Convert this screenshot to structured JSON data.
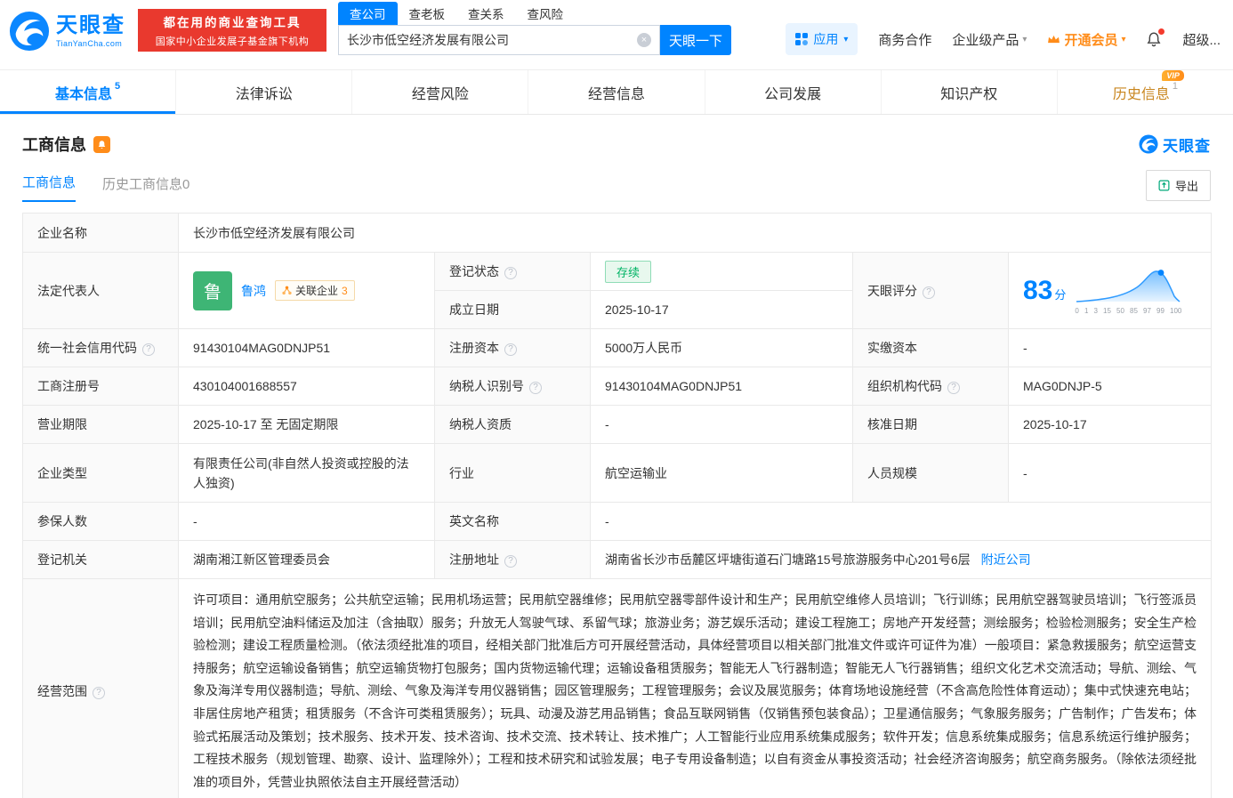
{
  "header": {
    "brand": "天眼查",
    "brand_domain": "TianYanCha.com",
    "slogan_line1": "都在用的商业查询工具",
    "slogan_line2": "国家中小企业发展子基金旗下机构",
    "search_tabs": [
      {
        "label": "查公司"
      },
      {
        "label": "查老板"
      },
      {
        "label": "查关系"
      },
      {
        "label": "查风险"
      }
    ],
    "search_value": "长沙市低空经济发展有限公司",
    "search_button": "天眼一下",
    "apps_label": "应用",
    "link_business": "商务合作",
    "link_enterprise": "企业级产品",
    "link_vip": "开通会员",
    "link_super": "超级..."
  },
  "tabs": [
    {
      "label": "基本信息",
      "count": "5"
    },
    {
      "label": "法律诉讼"
    },
    {
      "label": "经营风险"
    },
    {
      "label": "经营信息"
    },
    {
      "label": "公司发展"
    },
    {
      "label": "知识产权"
    },
    {
      "label": "历史信息",
      "count": "1",
      "vip": "VIP"
    }
  ],
  "section": {
    "title": "工商信息",
    "watermark": "天眼查",
    "subtab_current": "工商信息",
    "subtab_history": "历史工商信息0",
    "export": "导出"
  },
  "table": {
    "company_name": {
      "label": "企业名称",
      "value": "长沙市低空经济发展有限公司"
    },
    "legal_rep": {
      "label": "法定代表人",
      "avatar": "鲁",
      "name": "鲁鸿",
      "related_label": "关联企业",
      "related_count": "3"
    },
    "reg_status": {
      "label": "登记状态",
      "value": "存续"
    },
    "establish_date": {
      "label": "成立日期",
      "value": "2025-10-17"
    },
    "score": {
      "label": "天眼评分",
      "value": "83",
      "unit": "分",
      "axis": [
        "0",
        "1",
        "3",
        "15",
        "50",
        "85",
        "97",
        "99",
        "100"
      ]
    },
    "credit_code": {
      "label": "统一社会信用代码",
      "value": "91430104MAG0DNJP51"
    },
    "reg_capital": {
      "label": "注册资本",
      "value": "5000万人民币"
    },
    "paid_capital": {
      "label": "实缴资本",
      "value": "-"
    },
    "reg_number": {
      "label": "工商注册号",
      "value": "430104001688557"
    },
    "taxpayer_id": {
      "label": "纳税人识别号",
      "value": "91430104MAG0DNJP51"
    },
    "org_code": {
      "label": "组织机构代码",
      "value": "MAG0DNJP-5"
    },
    "business_term": {
      "label": "营业期限",
      "value": "2025-10-17 至 无固定期限"
    },
    "taxpayer_quality": {
      "label": "纳税人资质",
      "value": "-"
    },
    "approval_date": {
      "label": "核准日期",
      "value": "2025-10-17"
    },
    "company_type": {
      "label": "企业类型",
      "value": "有限责任公司(非自然人投资或控股的法人独资)"
    },
    "industry": {
      "label": "行业",
      "value": "航空运输业"
    },
    "staff_size": {
      "label": "人员规模",
      "value": "-"
    },
    "insured_count": {
      "label": "参保人数",
      "value": "-"
    },
    "english_name": {
      "label": "英文名称",
      "value": "-"
    },
    "reg_authority": {
      "label": "登记机关",
      "value": "湖南湘江新区管理委员会"
    },
    "reg_address": {
      "label": "注册地址",
      "value": "湖南省长沙市岳麓区坪塘街道石门塘路15号旅游服务中心201号6层",
      "nearby": "附近公司"
    },
    "business_scope": {
      "label": "经营范围",
      "value": "许可项目：通用航空服务；公共航空运输；民用机场运营；民用航空器维修；民用航空器零部件设计和生产；民用航空维修人员培训；飞行训练；民用航空器驾驶员培训；飞行签派员培训；民用航空油料储运及加注（含抽取）服务；升放无人驾驶气球、系留气球；旅游业务；游艺娱乐活动；建设工程施工；房地产开发经营；测绘服务；检验检测服务；安全生产检验检测；建设工程质量检测。（依法须经批准的项目，经相关部门批准后方可开展经营活动，具体经营项目以相关部门批准文件或许可证件为准）一般项目：紧急救援服务；航空运营支持服务；航空运输设备销售；航空运输货物打包服务；国内货物运输代理；运输设备租赁服务；智能无人飞行器制造；智能无人飞行器销售；组织文化艺术交流活动；导航、测绘、气象及海洋专用仪器制造；导航、测绘、气象及海洋专用仪器销售；园区管理服务；工程管理服务；会议及展览服务；体育场地设施经营（不含高危险性体育运动）；集中式快速充电站；非居住房地产租赁；租赁服务（不含许可类租赁服务）；玩具、动漫及游艺用品销售；食品互联网销售（仅销售预包装食品）；卫星通信服务；气象服务服务；广告制作；广告发布；体验式拓展活动及策划；技术服务、技术开发、技术咨询、技术交流、技术转让、技术推广；人工智能行业应用系统集成服务；软件开发；信息系统集成服务；信息系统运行维护服务；工程技术服务（规划管理、勘察、设计、监理除外）；工程和技术研究和试验发展；电子专用设备制造；以自有资金从事投资活动；社会经济咨询服务；航空商务服务。（除依法须经批准的项目外，凭营业执照依法自主开展经营活动）"
    }
  }
}
